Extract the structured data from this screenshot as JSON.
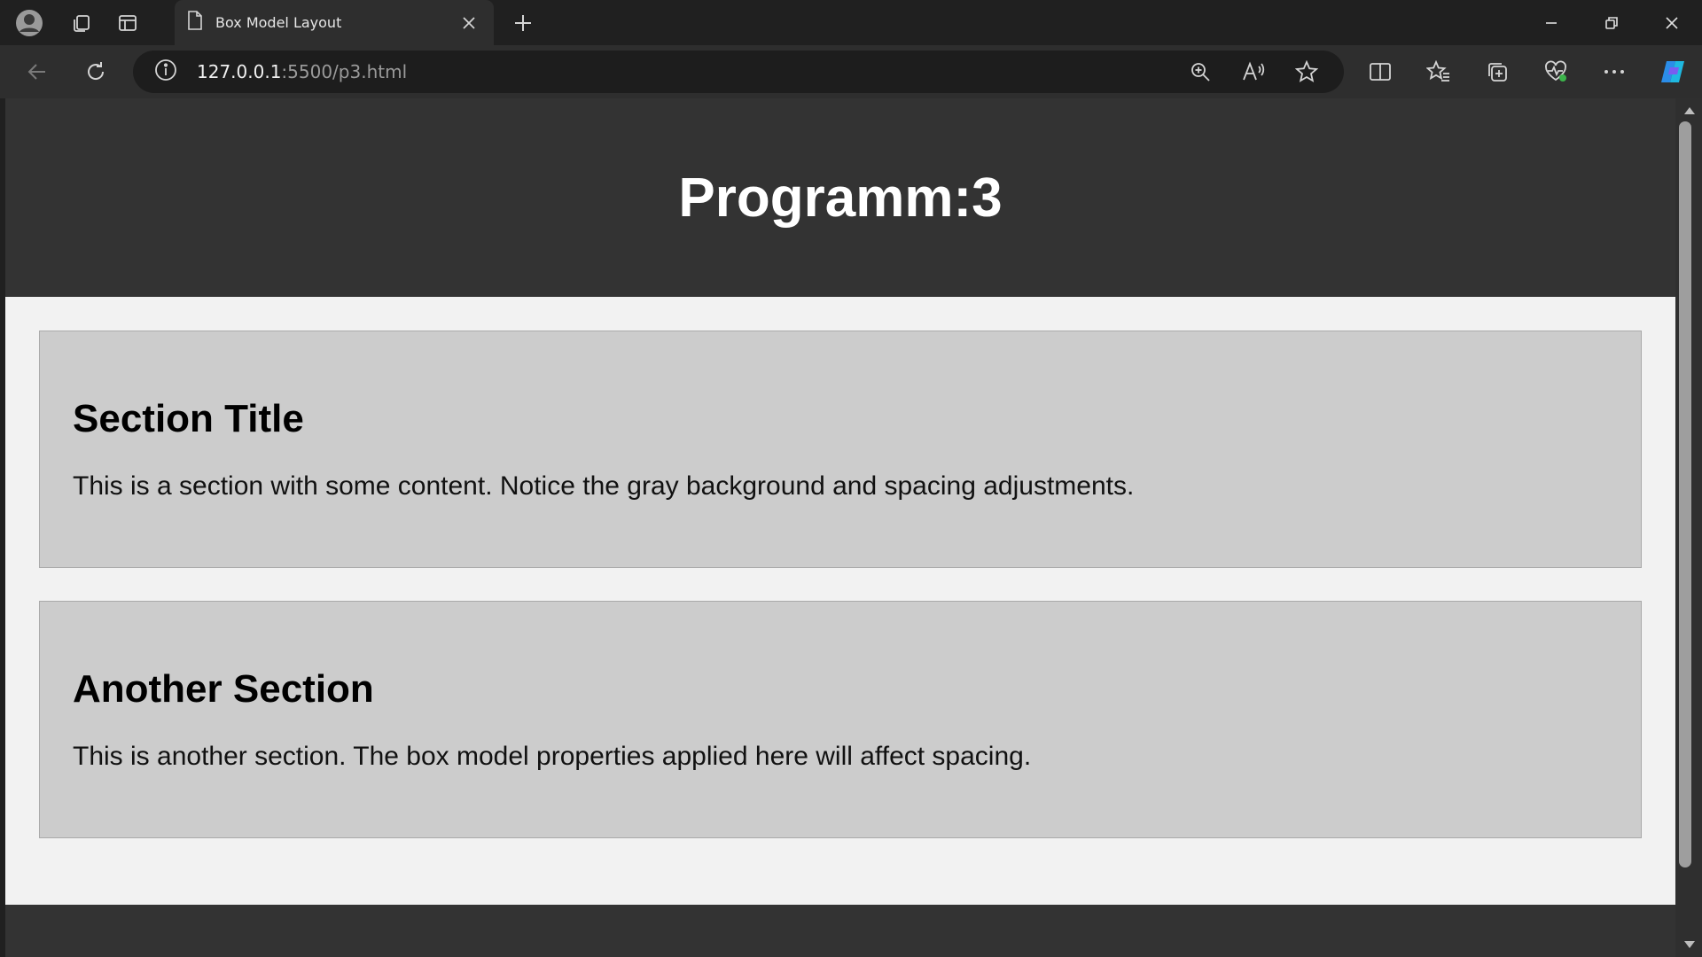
{
  "browser": {
    "tab_title": "Box Model Layout",
    "url_host": "127.0.0.1",
    "url_path": ":5500/p3.html"
  },
  "icons": {
    "profile": "profile-icon",
    "workspaces": "workspaces-icon",
    "tab_actions": "tab-actions-icon",
    "page": "page-icon",
    "close_tab": "close-icon",
    "new_tab": "plus-icon",
    "minimize": "minimize-icon",
    "restore": "restore-icon",
    "close_window": "close-icon",
    "back": "back-arrow-icon",
    "refresh": "refresh-icon",
    "site_info": "info-icon",
    "zoom": "zoom-in-icon",
    "read_aloud": "read-aloud-icon",
    "favorite": "star-icon",
    "split_screen": "split-screen-icon",
    "favorites": "favorites-icon",
    "collections": "collections-icon",
    "browser_essentials": "heart-pulse-icon",
    "more": "more-icon",
    "copilot": "copilot-icon"
  },
  "page": {
    "header_title": "Programm:3",
    "sections": [
      {
        "title": "Section Title",
        "text": "This is a section with some content. Notice the gray background and spacing adjustments."
      },
      {
        "title": "Another Section",
        "text": "This is another section. The box model properties applied here will affect spacing."
      }
    ]
  },
  "colors": {
    "header_bg": "#333333",
    "main_bg": "#f2f2f2",
    "section_bg": "#cccccc",
    "header_text": "#ffffff"
  }
}
